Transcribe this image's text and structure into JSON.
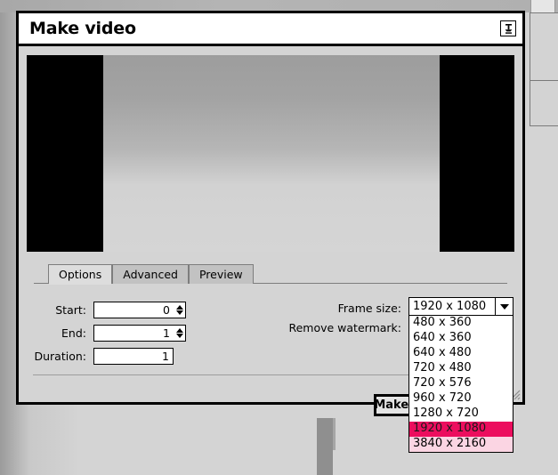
{
  "window": {
    "title": "Make video",
    "pin_icon": "pin-icon"
  },
  "preview": {
    "name": "video-preview"
  },
  "tabs": [
    {
      "label": "Options",
      "active": true
    },
    {
      "label": "Advanced",
      "active": false
    },
    {
      "label": "Preview",
      "active": false
    }
  ],
  "options": {
    "start": {
      "label": "Start:",
      "value": "0"
    },
    "end": {
      "label": "End:",
      "value": "1"
    },
    "duration": {
      "label": "Duration:",
      "value": "1"
    },
    "frame_size": {
      "label": "Frame size:",
      "value": "1920 x 1080",
      "arrow_icon": "chevron-down-icon",
      "options": [
        "480 x 360",
        "640 x 360",
        "640 x 480",
        "720 x 480",
        "720 x 576",
        "960 x 720",
        "1280 x 720",
        "1920 x 1080",
        "3840 x 2160"
      ],
      "selected": "1920 x 1080",
      "hovered": "3840 x 2160"
    },
    "remove_watermark": {
      "label": "Remove watermark:",
      "checked": false
    }
  },
  "actions": {
    "make_video": "Make video"
  },
  "colors": {
    "highlight": "#ec0e5e",
    "hover": "#fbd5e3",
    "dialog_bg": "#d4d4d4",
    "titlebar_bg": "#ffffff"
  }
}
